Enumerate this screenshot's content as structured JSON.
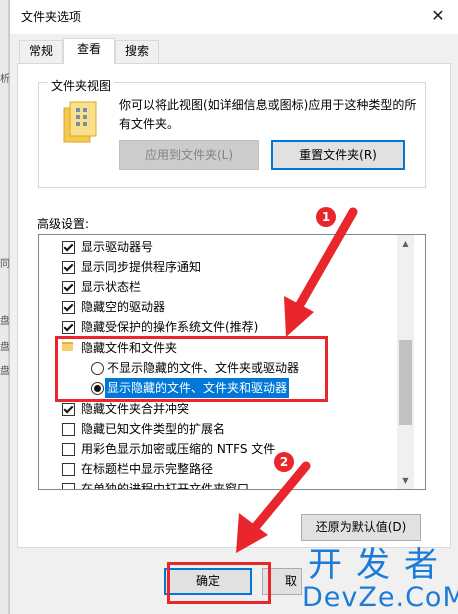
{
  "window": {
    "title": "文件夹选项",
    "close_glyph": "✕"
  },
  "tabs": [
    {
      "label": "常规"
    },
    {
      "label": "查看"
    },
    {
      "label": "搜索"
    }
  ],
  "folder_views": {
    "group_label": "文件夹视图",
    "description": "你可以将此视图(如详细信息或图标)应用于这种类型的所有文件夹。",
    "apply_button": "应用到文件夹(L)",
    "reset_button": "重置文件夹(R)"
  },
  "advanced": {
    "label": "高级设置:",
    "items": [
      {
        "type": "checkbox",
        "checked": true,
        "label": "显示驱动器号"
      },
      {
        "type": "checkbox",
        "checked": true,
        "label": "显示同步提供程序通知"
      },
      {
        "type": "checkbox",
        "checked": true,
        "label": "显示状态栏"
      },
      {
        "type": "checkbox",
        "checked": true,
        "label": "隐藏空的驱动器"
      },
      {
        "type": "checkbox",
        "checked": true,
        "label": "隐藏受保护的操作系统文件(推荐)"
      },
      {
        "type": "folder",
        "label": "隐藏文件和文件夹"
      },
      {
        "type": "radio",
        "checked": false,
        "label": "不显示隐藏的文件、文件夹或驱动器"
      },
      {
        "type": "radio",
        "checked": true,
        "label": "显示隐藏的文件、文件夹和驱动器"
      },
      {
        "type": "checkbox",
        "checked": true,
        "label": "隐藏文件夹合并冲突"
      },
      {
        "type": "checkbox",
        "checked": false,
        "label": "隐藏已知文件类型的扩展名"
      },
      {
        "type": "checkbox",
        "checked": false,
        "label": "用彩色显示加密或压缩的 NTFS 文件"
      },
      {
        "type": "checkbox",
        "checked": false,
        "label": "在标题栏中显示完整路径"
      },
      {
        "type": "checkbox",
        "checked": false,
        "label": "在单独的进程中打开文件夹窗口"
      }
    ]
  },
  "restore_defaults_button": "还原为默认值(D)",
  "ok_button": "确定",
  "cancel_button": "取",
  "annotations": {
    "badge1": "1",
    "badge2": "2",
    "color": "#e8262b"
  },
  "watermark": {
    "cn": "开发者",
    "en": "DevZe.CoM"
  },
  "background_window": {
    "marks": [
      "析",
      "同",
      "盘",
      "盘",
      "盘"
    ]
  },
  "colors": {
    "accent": "#0078d7",
    "annotation": "#e8262b",
    "watermark": "#1a7cd8"
  }
}
